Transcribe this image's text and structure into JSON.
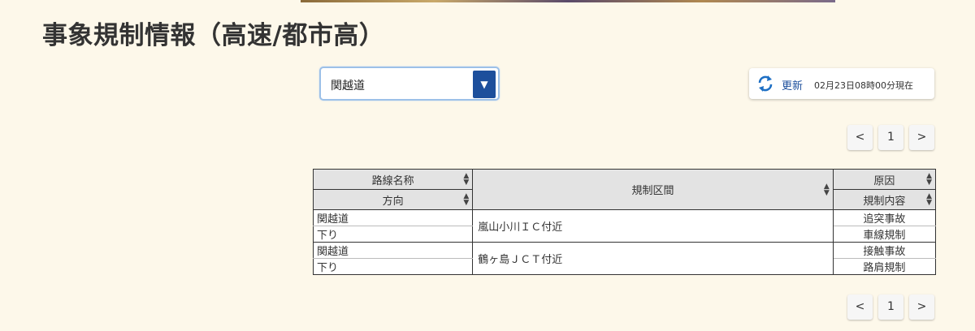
{
  "page": {
    "title": "事象規制情報（高速/都市高）"
  },
  "route_select": {
    "value": "関越道"
  },
  "refresh": {
    "label": "更新",
    "timestamp": "02月23日08時00分現在"
  },
  "pager": {
    "prev": "<",
    "page": "1",
    "next": ">"
  },
  "table": {
    "headers": {
      "route": "路線名称",
      "direction": "方向",
      "section": "規制区間",
      "cause": "原因",
      "regulation": "規制内容"
    },
    "rows": [
      {
        "route": "関越道",
        "direction": "下り",
        "section": "嵐山小川ＩＣ付近",
        "cause": "追突事故",
        "regulation": "車線規制"
      },
      {
        "route": "関越道",
        "direction": "下り",
        "section": "鶴ヶ島ＪＣＴ付近",
        "cause": "接触事故",
        "regulation": "路肩規制"
      }
    ]
  },
  "colors": {
    "background": "#fdf8ea",
    "accent": "#1d4f9c",
    "header_bg": "#e3e3e3"
  }
}
